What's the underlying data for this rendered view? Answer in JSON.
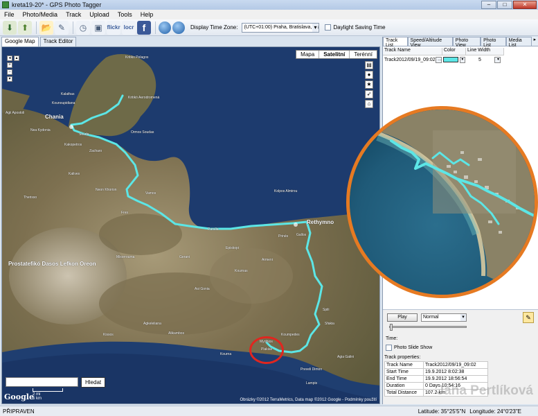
{
  "window": {
    "title": "kreta19-20* - GPS Photo Tagger",
    "minimize": "–",
    "maximize": "□",
    "close": "✕"
  },
  "menu": [
    "File",
    "Photo/Media",
    "Track",
    "Upload",
    "Tools",
    "Help"
  ],
  "toolbar": {
    "tz_label": "Display Time Zone:",
    "tz_value": "(UTC+01:00) Praha, Bratislava, Budapešť",
    "dst_label": "Daylight Saving Time",
    "flickr": "flickr",
    "locr": "locr",
    "facebook": "f"
  },
  "left_tabs": [
    "Google Map",
    "Track Editor"
  ],
  "map": {
    "types": [
      "Mapa",
      "Satelitní",
      "Terénní"
    ],
    "search_button": "Hledat",
    "scale_mi": "2 mi",
    "scale_km": "5 km",
    "google": "Google",
    "copyright": "Obrázky ©2012 TerraMetrics, Data map ©2012 Google - Podmínky použití",
    "labels": [
      "Chania",
      "Agii Apostoli",
      "Kounoupidiana",
      "Kalathas",
      "Souda",
      "Zacharo",
      "Ormos Soudas",
      "Vamos",
      "Kritiko Pelagos",
      "Kolpos Almirou",
      "Rethymno",
      "Paralia",
      "Episkopi",
      "Prinés",
      "Gallos",
      "Prostatefikó Dasos Lefkon Oreon",
      "Agkeleliana",
      "Sfakia",
      "Myrthios",
      "Plakias",
      "Spili",
      "Koumpedes",
      "Preveli Dimon",
      "Lampis",
      "Nea Kydonia",
      "Kalives",
      "Neon Khorion",
      "Therisso",
      "Fres",
      "Asi Gonia",
      "Kournas",
      "Alikambos",
      "Gerani",
      "Kakopetros",
      "Kritikó Aerodromená",
      "Kourna",
      "Armeni",
      "Mixorrouma",
      "Kissos",
      "Agia Galini"
    ]
  },
  "right_tabs": [
    "Track List",
    "Speed/Altitude View",
    "Photo View",
    "Photo List",
    "Media List"
  ],
  "track_grid": {
    "headers": [
      "Track Name",
      "Color",
      "Line Width"
    ],
    "rows": [
      {
        "name": "Track2012/09/19_09:02",
        "color": "#5ce6e6",
        "width": "5"
      }
    ]
  },
  "controls": {
    "play": "Play",
    "speed": "Normal",
    "time_label": "Time:",
    "slideshow": "Photo Slide Show",
    "props_label": "Track properties:",
    "properties": [
      {
        "key": "Track Name",
        "value": "Track2012/09/19_09:02"
      },
      {
        "key": "Start Time",
        "value": "19.9.2012 8:02:38"
      },
      {
        "key": "End Time",
        "value": "19.9.2012 18:56:54"
      },
      {
        "key": "Duration",
        "value": "0 Days 10:54:16"
      },
      {
        "key": "Total Distance",
        "value": "107.2 km"
      }
    ],
    "watermark": "Jana Pertlíková"
  },
  "status": {
    "state": "PŘIPRAVEN",
    "lat": "Latitude: 35°25'5\"N",
    "lon": "Longitude: 24°0'23\"E"
  },
  "colors": {
    "track": "#5ce6e6",
    "highlight_circle": "#e0261f",
    "zoom_border": "#e67a22"
  }
}
